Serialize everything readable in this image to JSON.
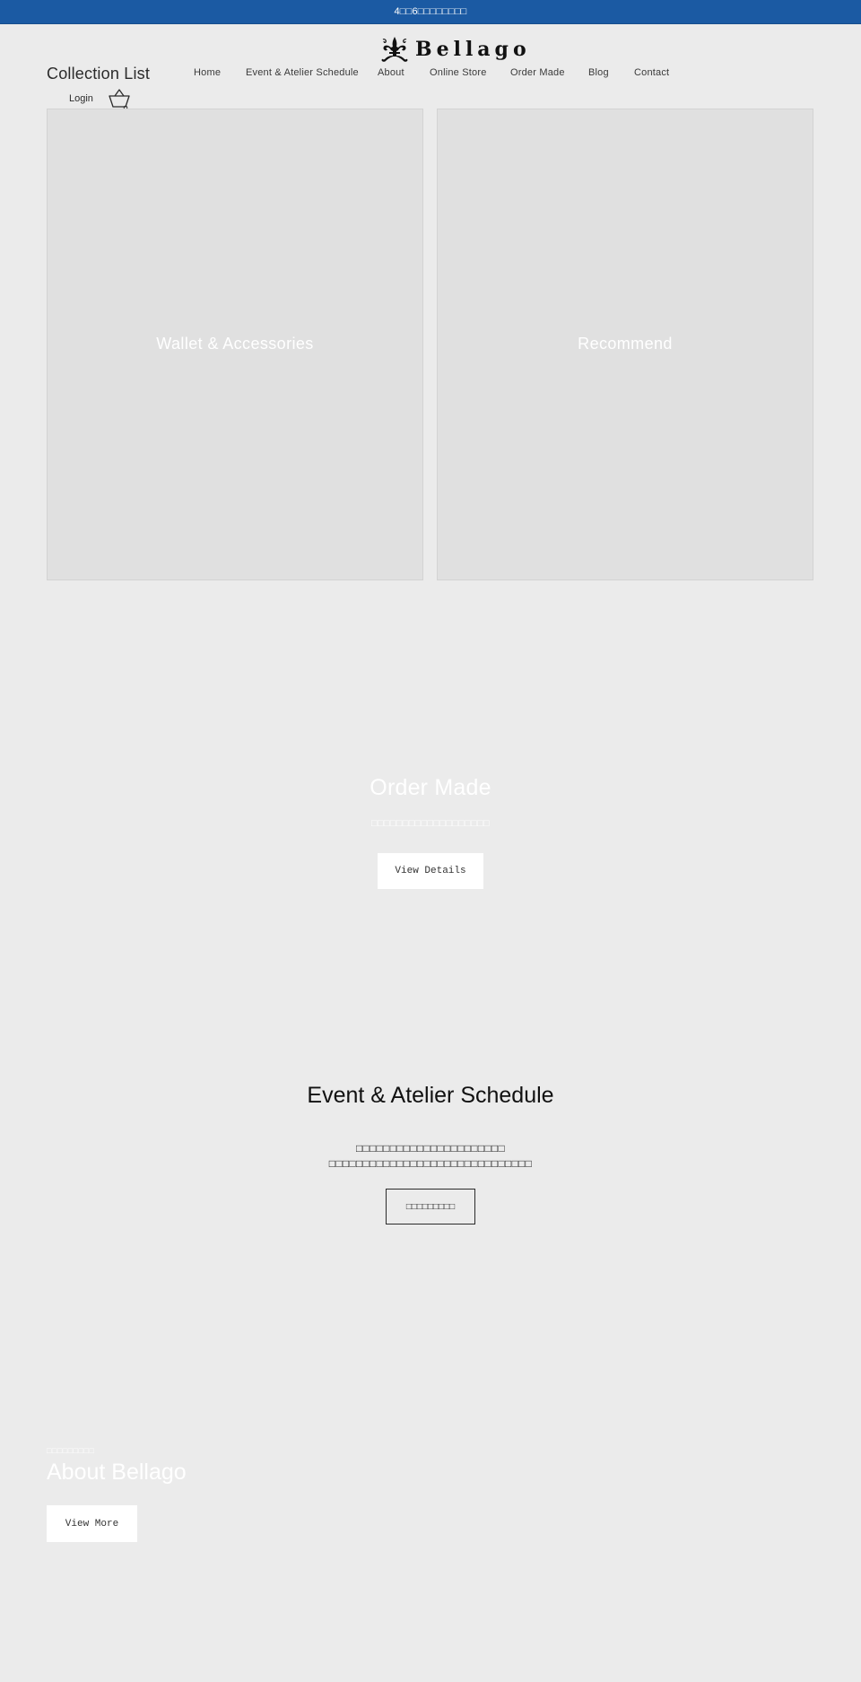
{
  "announcement": {
    "text": "4□□6□□□□□□□□"
  },
  "header": {
    "logo": {
      "text": "Bellago",
      "icon": "fleur-de-lis-icon"
    },
    "section_title": "Collection List",
    "nav": [
      {
        "label": "Home"
      },
      {
        "label": "Event & Atelier Schedule"
      },
      {
        "label": "About"
      },
      {
        "label": "Online Store"
      },
      {
        "label": "Order Made"
      },
      {
        "label": "Blog"
      },
      {
        "label": "Contact"
      }
    ],
    "login_label": "Login",
    "cart_icon": "shopping-basket-icon"
  },
  "collections": [
    {
      "label": "Wallet & Accessories"
    },
    {
      "label": "Recommend"
    }
  ],
  "order_made": {
    "title": "Order Made",
    "subtitle": "□□□□□□□□□□□□□□□□□□□",
    "button_label": "View Details"
  },
  "event_schedule": {
    "title": "Event & Atelier Schedule",
    "lines": [
      "□□□□□□□□□□□□□□□□□□□□□□",
      "□□□□□□□□□□□□□□□□□□□□□□□□□□□□□□"
    ],
    "button_label": "□□□□□□□□□"
  },
  "about": {
    "eyebrow": "□□□□□□□□□",
    "title": "About Bellago",
    "button_label": "View More"
  }
}
